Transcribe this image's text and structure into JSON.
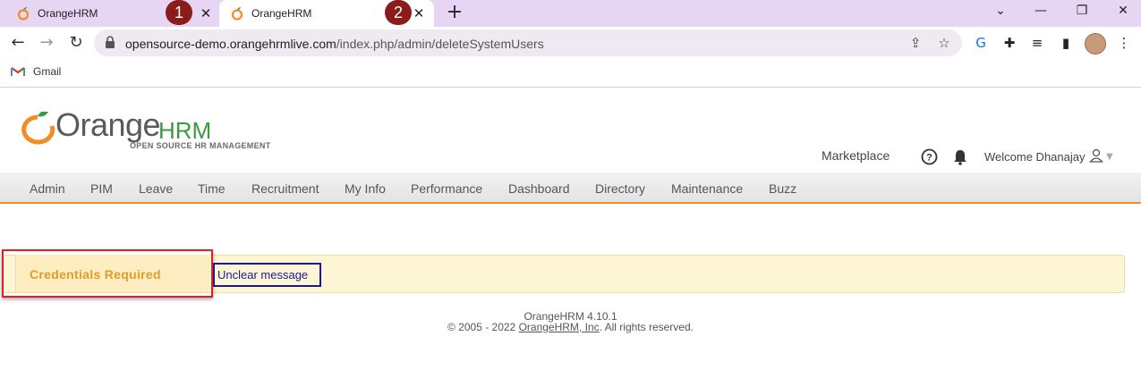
{
  "browser": {
    "tabs": [
      {
        "title": "OrangeHRM",
        "badge": "1"
      },
      {
        "title": "OrangeHRM",
        "badge": "2"
      }
    ],
    "url_host": "opensource-demo.orangehrmlive.com",
    "url_path": "/index.php/admin/deleteSystemUsers",
    "bookmarks": [
      {
        "label": "Gmail"
      }
    ]
  },
  "hrm": {
    "logo": {
      "orange": "Orange",
      "hrm": "HRM",
      "subtitle": "OPEN SOURCE HR MANAGEMENT"
    },
    "marketplace": "Marketplace",
    "welcome": "Welcome Dhanajay",
    "menu": [
      "Admin",
      "PIM",
      "Leave",
      "Time",
      "Recruitment",
      "My Info",
      "Performance",
      "Dashboard",
      "Directory",
      "Maintenance",
      "Buzz"
    ],
    "message": {
      "title": "Credentials Required",
      "annotation": "Unclear message"
    },
    "footer": {
      "version": "OrangeHRM 4.10.1",
      "copy_prefix": "© 2005 - 2022 ",
      "company": "OrangeHRM, Inc",
      "copy_suffix": ". All rights reserved."
    }
  },
  "colors": {
    "accent": "#f28c28",
    "tab_strip": "#e6d5f3",
    "message_bg": "#fdf5d3",
    "annotation_red": "#e02020",
    "annotation_blue": "#1a1a99"
  }
}
